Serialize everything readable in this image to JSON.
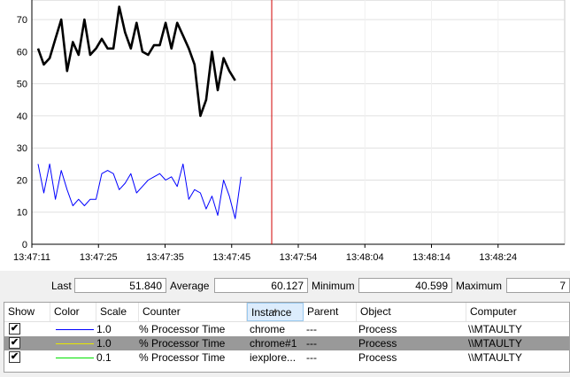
{
  "chart_data": {
    "type": "line",
    "x_ticks": [
      "13:47:11",
      "13:47:25",
      "13:47:35",
      "13:47:45",
      "13:47:54",
      "13:48:04",
      "13:48:14",
      "13:48:24"
    ],
    "y_ticks": [
      0,
      10,
      20,
      30,
      40,
      50,
      60,
      70
    ],
    "ylim": [
      0,
      75
    ],
    "cursor_index": 38,
    "series": [
      {
        "color": "#000000",
        "values": [
          61,
          56,
          58,
          64,
          70,
          54,
          63,
          59,
          70,
          59,
          61,
          64,
          61,
          61,
          74,
          66,
          61,
          69,
          60,
          59,
          62,
          62,
          69,
          61,
          69,
          65,
          61,
          56,
          40,
          45,
          60,
          48,
          58,
          54,
          51
        ]
      },
      {
        "color": "#0000ff",
        "values": [
          25,
          16,
          25,
          14,
          23,
          17,
          12,
          14,
          12,
          14,
          14,
          22,
          23,
          22,
          17,
          19,
          22,
          16,
          18,
          20,
          21,
          22,
          20,
          21,
          18,
          25,
          14,
          17,
          16,
          11,
          15,
          9,
          20,
          15,
          8,
          21
        ]
      }
    ]
  },
  "stats": {
    "last_label": "Last",
    "last_value": "51.840",
    "average_label": "Average",
    "average_value": "60.127",
    "minimum_label": "Minimum",
    "minimum_value": "40.599",
    "maximum_label": "Maximum",
    "maximum_value": "7"
  },
  "table": {
    "headers": [
      "Show",
      "Color",
      "Scale",
      "Counter",
      "Instance",
      "Parent",
      "Object",
      "Computer"
    ],
    "rows": [
      {
        "show": "✔",
        "color": "#0000ff",
        "scale": "1.0",
        "counter": "% Processor Time",
        "instance": "chrome",
        "parent": "---",
        "object": "Process",
        "computer": "\\\\MTAULTY",
        "selected": false
      },
      {
        "show": "✔",
        "color": "#e8e800",
        "scale": "1.0",
        "counter": "% Processor Time",
        "instance": "chrome#1",
        "parent": "---",
        "object": "Process",
        "computer": "\\\\MTAULTY",
        "selected": true
      },
      {
        "show": "✔",
        "color": "#00e000",
        "scale": "0.1",
        "counter": "% Processor Time",
        "instance": "iexplore...",
        "parent": "---",
        "object": "Process",
        "computer": "\\\\MTAULTY",
        "selected": false
      }
    ]
  }
}
